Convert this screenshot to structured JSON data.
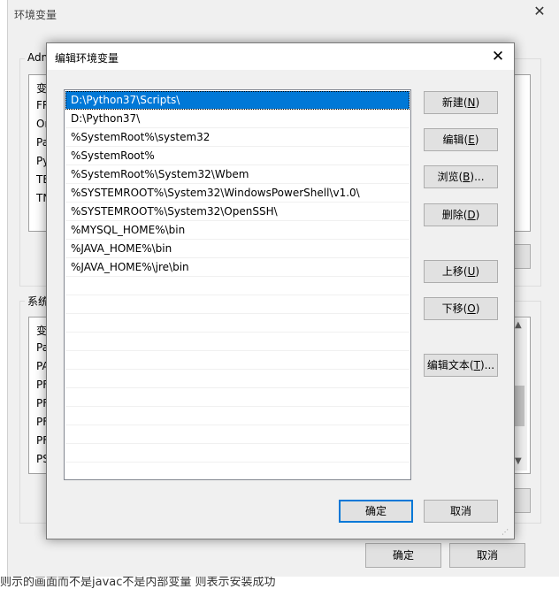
{
  "background_window": {
    "title": "环境变量",
    "user_group_label": "Adm",
    "user_list_header": "变",
    "user_rows": [
      "FR",
      "Or",
      "Pa",
      "Py",
      "TE",
      "TN"
    ],
    "system_group_label": "系统",
    "system_list_header": "变",
    "system_rows": [
      "Pa",
      "PA",
      "PF",
      "PF",
      "PF",
      "PF",
      "PS"
    ],
    "ok_label": "确定",
    "cancel_label": "取消",
    "footer_text": "则示的画面而不是javac不是内部变量    则表示安装成功"
  },
  "dialog": {
    "title": "编辑环境变量",
    "paths": [
      "D:\\Python37\\Scripts\\",
      "D:\\Python37\\",
      "%SystemRoot%\\system32",
      "%SystemRoot%",
      "%SystemRoot%\\System32\\Wbem",
      "%SYSTEMROOT%\\System32\\WindowsPowerShell\\v1.0\\",
      "%SYSTEMROOT%\\System32\\OpenSSH\\",
      "%MYSQL_HOME%\\bin",
      "%JAVA_HOME%\\bin",
      "%JAVA_HOME%\\jre\\bin"
    ],
    "selected_index": 0,
    "buttons": {
      "new": {
        "text": "新建(",
        "key": "N",
        "tail": ")"
      },
      "edit": {
        "text": "编辑(",
        "key": "E",
        "tail": ")"
      },
      "browse": {
        "text": "浏览(",
        "key": "B",
        "tail": ")..."
      },
      "delete": {
        "text": "删除(",
        "key": "D",
        "tail": ")"
      },
      "move_up": {
        "text": "上移(",
        "key": "U",
        "tail": ")"
      },
      "move_down": {
        "text": "下移(",
        "key": "O",
        "tail": ")"
      },
      "edit_text": {
        "text": "编辑文本(",
        "key": "T",
        "tail": ")..."
      }
    },
    "ok_label": "确定",
    "cancel_label": "取消"
  },
  "colors": {
    "selection": "#0078d7",
    "window_bg": "#f0f0f0",
    "button_bg": "#e1e1e1"
  }
}
